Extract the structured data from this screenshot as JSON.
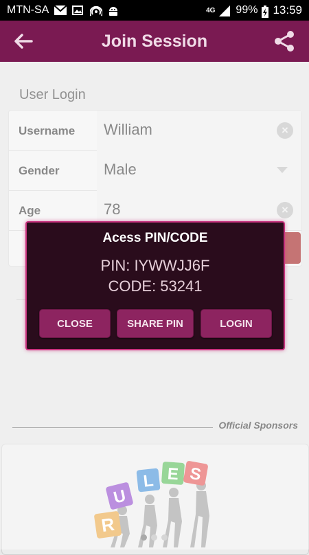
{
  "status_bar": {
    "carrier": "MTN-SA",
    "network": "4G",
    "battery": "99%",
    "time": "13:59",
    "icons": [
      "mail-icon",
      "image-icon",
      "hotspot-icon",
      "android-icon",
      "signal-icon",
      "battery-charging-icon"
    ]
  },
  "app_bar": {
    "title": "Join Session",
    "back_icon": "back-arrow-icon",
    "share_icon": "share-icon",
    "color": "#7a1a52"
  },
  "form": {
    "section_title": "User Login",
    "fields": [
      {
        "label": "Username",
        "value": "William",
        "icon": "clear-icon"
      },
      {
        "label": "Gender",
        "value": "Male",
        "icon": "dropdown-arrow-icon"
      },
      {
        "label": "Age",
        "value": "78",
        "icon": "clear-icon"
      }
    ]
  },
  "sponsors": {
    "label": "Official Sponsors",
    "banner_letters": [
      "R",
      "U",
      "L",
      "E",
      "S"
    ]
  },
  "dialog": {
    "title": "Acess PIN/CODE",
    "pin": "PIN: IYWWJJ6F",
    "code": "CODE: 53241",
    "buttons": {
      "close": "CLOSE",
      "share_pin": "SHARE PIN",
      "login": "LOGIN"
    },
    "border_color": "#c8337f",
    "button_color": "#8d2460"
  }
}
